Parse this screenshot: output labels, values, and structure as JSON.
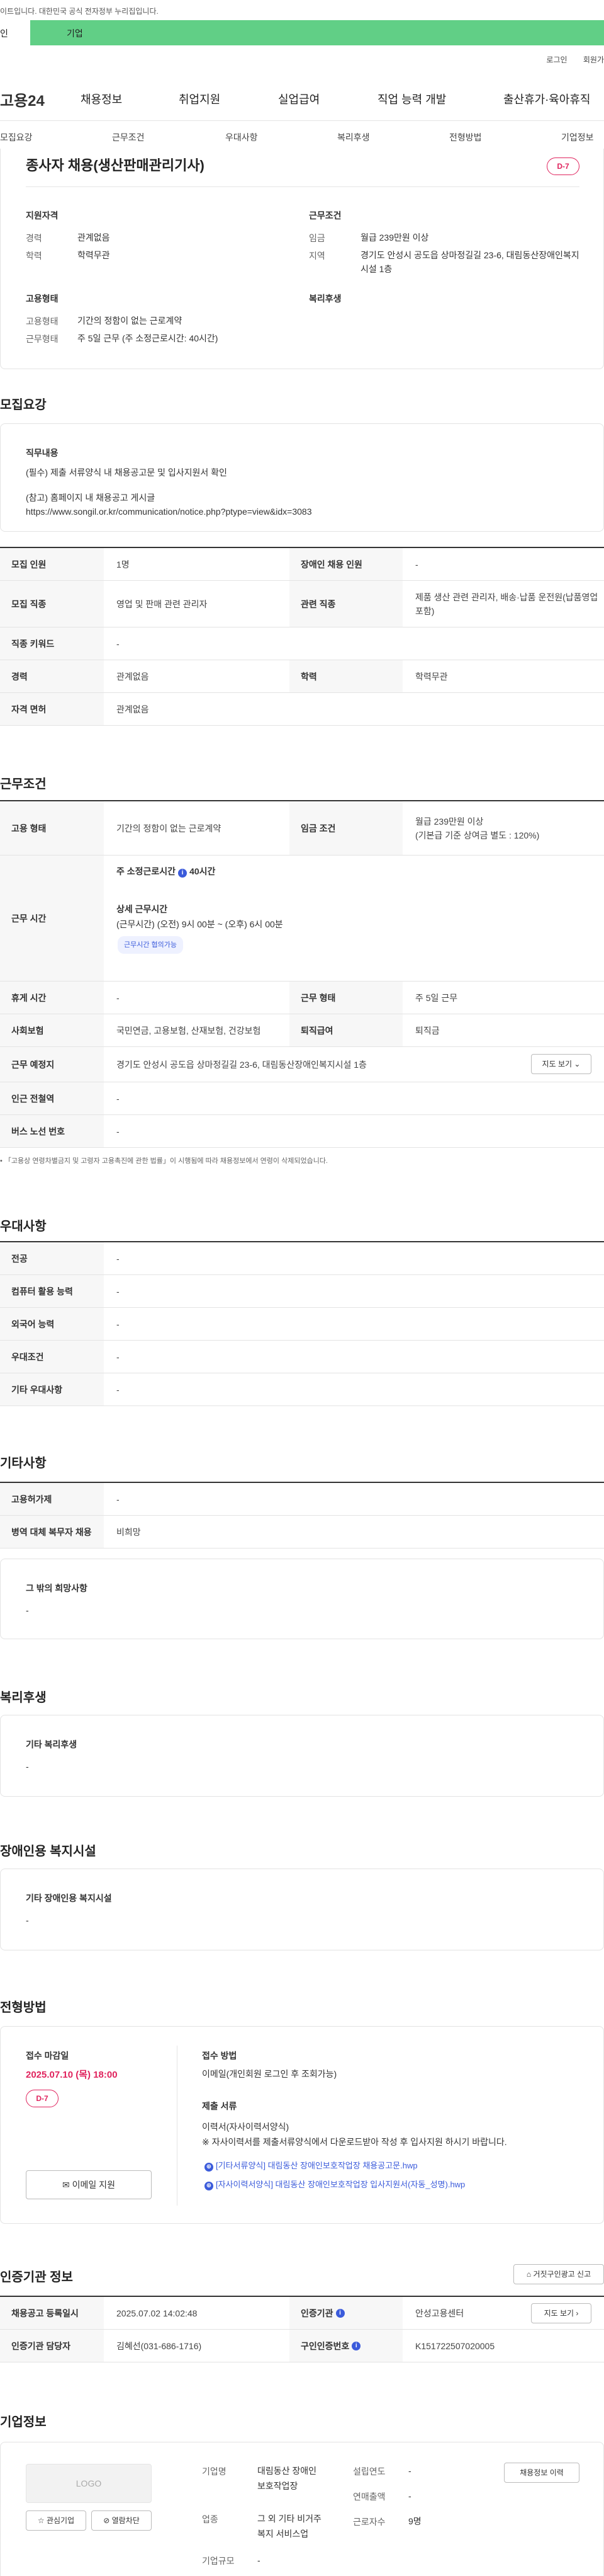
{
  "header": {
    "notice": "이트입니다. 대한민국 공식 전자정부 누리집입니다.",
    "user_type_personal": "인",
    "user_type_company": "기업",
    "login": "로그인",
    "join": "회원가",
    "logo": "고용24",
    "menu": [
      "채용정보",
      "취업지원",
      "실업급여",
      "직업 능력 개발",
      "출산휴가·육아휴직"
    ]
  },
  "subtabs": [
    "모집요강",
    "근무조건",
    "우대사항",
    "복리후생",
    "전형방법",
    "기업정보"
  ],
  "summary": {
    "title": "종사자 채용(생산판매관리기사)",
    "dday": "D-7",
    "qual_title": "지원자격",
    "qual": [
      {
        "label": "경력",
        "value": "관계없음"
      },
      {
        "label": "학력",
        "value": "학력무관"
      }
    ],
    "cond_title": "근무조건",
    "cond": [
      {
        "label": "임금",
        "value": "월급 239만원 이상"
      },
      {
        "label": "지역",
        "value": "경기도 안성시 공도읍 상마정길길 23-6, 대림동산장애인복지시설 1층"
      }
    ],
    "emp_title": "고용형태",
    "emp": [
      {
        "label": "고용형태",
        "value": "기간의 정함이 없는 근로계약"
      },
      {
        "label": "근무형태",
        "value": "주 5일 근무 (주 소정근로시간: 40시간)"
      }
    ],
    "welfare_title": "복리후생"
  },
  "recruit": {
    "title": "모집요강",
    "duty_title": "직무내용",
    "duty_lines": [
      "(필수) 제출 서류양식 내 채용공고문 및 입사지원서 확인",
      "(참고) 홈페이지 내 채용공고 게시글",
      "https://www.songil.or.kr/communication/notice.php?ptype=view&idx=3083"
    ],
    "rows": [
      {
        "k1": "모집 인원",
        "v1": "1명",
        "k2": "장애인 채용 인원",
        "v2": "-"
      },
      {
        "k1": "모집 직종",
        "v1": "영업 및 판매 관련 관리자",
        "k2": "관련 직종",
        "v2": "제품 생산 관련 관리자, 배송·납품 운전원(납품영업 포함)"
      },
      {
        "k1": "직종 키워드",
        "v1": "-"
      },
      {
        "k1": "경력",
        "v1": "관계없음",
        "k2": "학력",
        "v2": "학력무관"
      },
      {
        "k1": "자격 면허",
        "v1": "관계없음"
      }
    ]
  },
  "work": {
    "title": "근무조건",
    "emp_type_k": "고용 형태",
    "emp_type_v": "기간의 정함이 없는 근로계약",
    "wage_k": "임금 조건",
    "wage_v1": "월급 239만원 이상",
    "wage_v2": "(기본급 기준 상여금 별도 : 120%)",
    "hours_k": "근무 시간",
    "hours_week": "주 소정근로시간",
    "hours_week_v": "40시간",
    "hours_detail_title": "상세 근무시간",
    "hours_detail": "(근무시간) (오전) 9시 00분 ~ (오후) 6시 00분",
    "hours_pill": "근무시간 협의가능",
    "rest_k": "휴게 시간",
    "rest_v": "-",
    "form_k": "근무 형태",
    "form_v": "주 5일 근무",
    "ins_k": "사회보험",
    "ins_v": "국민연금, 고용보험, 산재보험, 건강보험",
    "sev_k": "퇴직급여",
    "sev_v": "퇴직금",
    "loc_k": "근무 예정지",
    "loc_v": "경기도 안성시 공도읍 상마정길길 23-6, 대림동산장애인복지시설 1층",
    "map_btn": "지도 보기",
    "subway_k": "인근 전철역",
    "subway_v": "-",
    "bus_k": "버스 노선 번호",
    "bus_v": "-",
    "footnote": "「고용상 연령차별금지 및 고령자 고용촉진에 관한 법률」이 시행됨에 따라 채용정보에서 연령이 삭제되었습니다."
  },
  "prefer": {
    "title": "우대사항",
    "rows": [
      {
        "k": "전공",
        "v": "-"
      },
      {
        "k": "컴퓨터 활용 능력",
        "v": "-"
      },
      {
        "k": "외국어 능력",
        "v": "-"
      },
      {
        "k": "우대조건",
        "v": "-"
      },
      {
        "k": "기타 우대사항",
        "v": "-"
      }
    ]
  },
  "etc": {
    "title": "기타사항",
    "rows": [
      {
        "k": "고용허가제",
        "v": "-"
      },
      {
        "k": "병역 대체 복무자 채용",
        "v": "비희망"
      }
    ],
    "hope_title": "그 밖의 희망사항",
    "hope_v": "-"
  },
  "welfare": {
    "title": "복리후생",
    "box_title": "기타 복리후생",
    "box_v": "-"
  },
  "disabled": {
    "title": "장애인용 복지시설",
    "box_title": "기타 장애인용 복지시설",
    "box_v": "-"
  },
  "process": {
    "title": "전형방법",
    "deadline_title": "접수 마감일",
    "deadline": "2025.07.10 (목) 18:00",
    "dday": "D-7",
    "apply_btn": "이메일 지원",
    "method_title": "접수 방법",
    "method_v": "이메일(개인회원 로그인 후 조회가능)",
    "docs_title": "제출 서류",
    "docs_v1": "이력서(자사이력서양식)",
    "docs_v2": "※ 자사이력서를 제출서류양식에서 다운로드받아 작성 후 입사지원 하시기 바랍니다.",
    "file1": "[기타서류양식] 대림동산 장애인보호작업장 채용공고문.hwp",
    "file2": "[자사이력서양식] 대림동산 장애인보호작업장 입사지원서(자동_성명).hwp"
  },
  "cert": {
    "title": "인증기관 정보",
    "report_btn": "거짓구인광고 신고",
    "r1k1": "채용공고 등록일시",
    "r1v1": "2025.07.02 14:02:48",
    "r1k2": "인증기관",
    "r1v2": "안성고용센터",
    "map_btn": "지도 보기",
    "r2k1": "인증기관 담당자",
    "r2v1": "김혜선(031-686-1716)",
    "r2k2": "구인인증번호",
    "r2v2": "K151722507020005"
  },
  "company": {
    "title": "기업정보",
    "logo": "LOGO",
    "fav_btn": "관심기업",
    "block_btn": "열람차단",
    "name_k": "기업명",
    "name_v1": "대림동산 장애인",
    "name_v2": "보호작업장",
    "industry_k": "업종",
    "industry_v1": "그 외 기타 비거주",
    "industry_v2": "복지 서비스업",
    "size_k": "기업규모",
    "size_v": "-",
    "year_k": "설립연도",
    "year_v": "-",
    "sales_k": "연매출액",
    "sales_v": "-",
    "staff_k": "근로자수",
    "staff_v": "9명",
    "history_btn": "채용정보 이력"
  }
}
